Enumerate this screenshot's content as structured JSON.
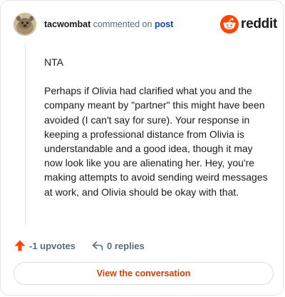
{
  "header": {
    "username": "tacwombat",
    "action_text": "commented on",
    "target_link": "post"
  },
  "brand": {
    "name": "reddit",
    "icon": "reddit-snoo-icon",
    "color": "#ff4500"
  },
  "comment": {
    "paragraphs": [
      "NTA",
      "Perhaps if Olivia had clarified what you and the company meant by \"partner\" this might have been avoided (I can't say for sure). Your response in keeping a professional distance from Olivia is understandable and a good idea, though it may now look like you are alienating her. Hey, you're making attempts to avoid sending weird messages at work, and Olivia should be okay with that."
    ]
  },
  "actions": {
    "upvotes_label": "-1 upvotes",
    "replies_label": "0 replies",
    "upvote_icon": "upvote-arrow-icon",
    "reply_icon": "reply-arrow-icon"
  },
  "footer": {
    "view_button_label": "View the conversation",
    "accent_color": "#d93a00"
  }
}
